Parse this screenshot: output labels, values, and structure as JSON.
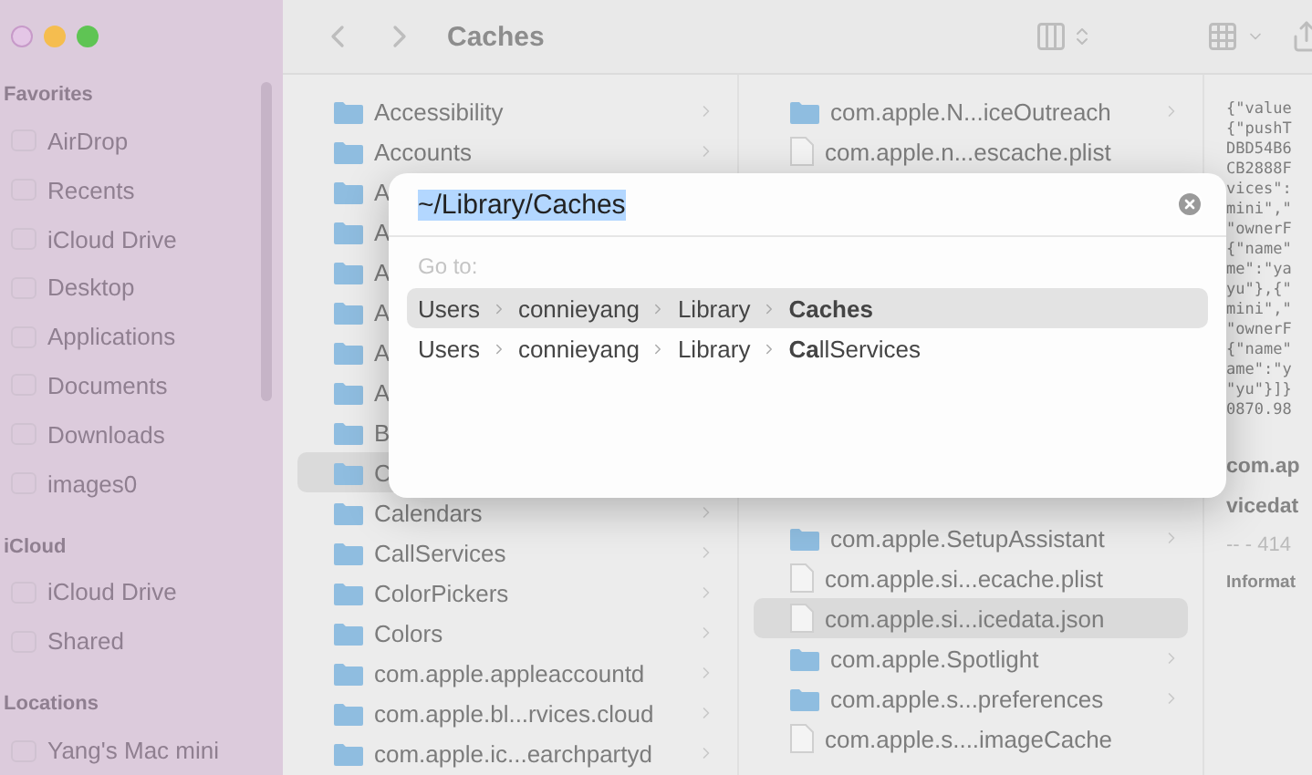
{
  "window": {
    "title": "Caches"
  },
  "sidebar": {
    "sections": [
      {
        "header": "Favorites",
        "items": [
          {
            "label": "AirDrop"
          },
          {
            "label": "Recents"
          },
          {
            "label": "iCloud Drive"
          },
          {
            "label": "Desktop"
          },
          {
            "label": "Applications"
          },
          {
            "label": "Documents"
          },
          {
            "label": "Downloads"
          },
          {
            "label": "images0"
          }
        ]
      },
      {
        "header": "iCloud",
        "items": [
          {
            "label": "iCloud Drive"
          },
          {
            "label": "Shared"
          }
        ]
      },
      {
        "header": "Locations",
        "items": [
          {
            "label": "Yang's Mac mini"
          }
        ]
      }
    ]
  },
  "column_1": {
    "items": [
      {
        "name": "Accessibility",
        "kind": "folder",
        "selected": false,
        "has_chevron": true
      },
      {
        "name": "Accounts",
        "kind": "folder",
        "selected": false,
        "has_chevron": true
      },
      {
        "name": "A",
        "kind": "folder",
        "selected": false,
        "has_chevron": false
      },
      {
        "name": "A",
        "kind": "folder",
        "selected": false,
        "has_chevron": false
      },
      {
        "name": "A",
        "kind": "folder",
        "selected": false,
        "has_chevron": false
      },
      {
        "name": "A",
        "kind": "folder",
        "selected": false,
        "has_chevron": false
      },
      {
        "name": "A",
        "kind": "folder",
        "selected": false,
        "has_chevron": false
      },
      {
        "name": "A",
        "kind": "folder",
        "selected": false,
        "has_chevron": false
      },
      {
        "name": "B",
        "kind": "folder",
        "selected": false,
        "has_chevron": false
      },
      {
        "name": "C",
        "kind": "folder",
        "selected": true,
        "has_chevron": false
      },
      {
        "name": "Calendars",
        "kind": "folder",
        "selected": false,
        "has_chevron": true
      },
      {
        "name": "CallServices",
        "kind": "folder",
        "selected": false,
        "has_chevron": true
      },
      {
        "name": "ColorPickers",
        "kind": "folder",
        "selected": false,
        "has_chevron": true
      },
      {
        "name": "Colors",
        "kind": "folder",
        "selected": false,
        "has_chevron": true
      },
      {
        "name": "com.apple.appleaccountd",
        "kind": "folder",
        "selected": false,
        "has_chevron": true
      },
      {
        "name": "com.apple.bl...rvices.cloud",
        "kind": "folder",
        "selected": false,
        "has_chevron": true
      },
      {
        "name": "com.apple.ic...earchpartyd",
        "kind": "folder",
        "selected": false,
        "has_chevron": true
      }
    ]
  },
  "column_2": {
    "top_items": [
      {
        "name": "com.apple.N...iceOutreach",
        "kind": "folder",
        "selected": false,
        "has_chevron": true
      },
      {
        "name": "com.apple.n...escache.plist",
        "kind": "file",
        "selected": false,
        "has_chevron": false
      }
    ],
    "bottom_items": [
      {
        "name": "com.apple.SetupAssistant",
        "kind": "folder",
        "selected": false,
        "has_chevron": true
      },
      {
        "name": "com.apple.si...ecache.plist",
        "kind": "file",
        "selected": false,
        "has_chevron": false
      },
      {
        "name": "com.apple.si...icedata.json",
        "kind": "file",
        "selected": true,
        "has_chevron": false
      },
      {
        "name": "com.apple.Spotlight",
        "kind": "folder",
        "selected": false,
        "has_chevron": true
      },
      {
        "name": "com.apple.s...preferences",
        "kind": "folder",
        "selected": false,
        "has_chevron": true
      },
      {
        "name": "com.apple.s....imageCache",
        "kind": "file",
        "selected": false,
        "has_chevron": false
      }
    ]
  },
  "preview": {
    "content_lines": [
      "{\"value",
      "{\"pushT",
      "DBD54B6",
      "CB2888F",
      "vices\":",
      "mini\",\"",
      "\"ownerF",
      "{\"name\"",
      "me\":\"ya",
      "yu\"},{\"",
      "mini\",\"",
      "\"ownerF",
      "{\"name\"",
      "ame\":\"y",
      "\"yu\"}]}",
      "0870.98"
    ],
    "title_lines": [
      "com.ap",
      "vicedat"
    ],
    "meta": "-- - 414",
    "section": "Informat"
  },
  "go_to_dialog": {
    "value": "~/Library/Caches",
    "hint": "Go to:",
    "suggestions": [
      {
        "segments": [
          "Users",
          "connieyang",
          "Library",
          "**Caches**"
        ],
        "selected": true
      },
      {
        "segments": [
          "Users",
          "connieyang",
          "Library",
          "**Ca**llServices"
        ],
        "selected": false
      }
    ]
  }
}
